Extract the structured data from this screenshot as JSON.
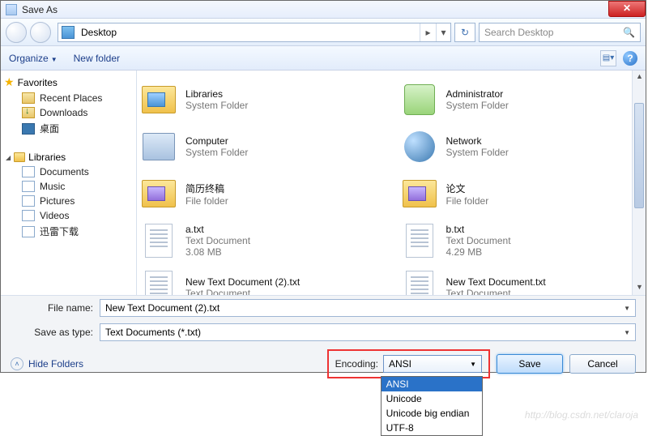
{
  "window": {
    "title": "Save As"
  },
  "nav": {
    "location": "Desktop",
    "chevron": "▸",
    "refresh_glyph": "↻"
  },
  "search": {
    "placeholder": "Search Desktop"
  },
  "toolbar": {
    "organize": "Organize",
    "new_folder": "New folder"
  },
  "sidebar": {
    "favorites_label": "Favorites",
    "favorites": [
      {
        "label": "Recent Places",
        "ic": "recent"
      },
      {
        "label": "Downloads",
        "ic": "dl"
      },
      {
        "label": "桌面",
        "ic": "desk"
      }
    ],
    "libraries_label": "Libraries",
    "libraries": [
      {
        "label": "Documents",
        "ic": "doc"
      },
      {
        "label": "Music",
        "ic": "music"
      },
      {
        "label": "Pictures",
        "ic": "pic"
      },
      {
        "label": "Videos",
        "ic": "vid"
      },
      {
        "label": "迅雷下载",
        "ic": "xl"
      }
    ]
  },
  "items": [
    {
      "name": "Libraries",
      "desc": "System Folder",
      "icon": "fold-blue"
    },
    {
      "name": "Administrator",
      "desc": "System Folder",
      "icon": "user"
    },
    {
      "name": "Computer",
      "desc": "System Folder",
      "icon": "comp"
    },
    {
      "name": "Network",
      "desc": "System Folder",
      "icon": "globe"
    },
    {
      "name": "简历终稿",
      "desc": "File folder",
      "icon": "fold-purple"
    },
    {
      "name": "论文",
      "desc": "File folder",
      "icon": "fold-purple"
    },
    {
      "name": "a.txt",
      "desc": "Text Document",
      "desc2": "3.08 MB",
      "icon": "txt"
    },
    {
      "name": "b.txt",
      "desc": "Text Document",
      "desc2": "4.29 MB",
      "icon": "txt"
    },
    {
      "name": "New Text Document (2).txt",
      "desc": "Text Document",
      "icon": "txt"
    },
    {
      "name": "New Text Document.txt",
      "desc": "Text Document",
      "icon": "txt"
    }
  ],
  "fields": {
    "file_name_label": "File name:",
    "file_name_value": "New Text Document (2).txt",
    "save_type_label": "Save as type:",
    "save_type_value": "Text Documents (*.txt)"
  },
  "bottom": {
    "hide_folders": "Hide Folders",
    "encoding_label": "Encoding:",
    "encoding_value": "ANSI",
    "encoding_options": [
      "ANSI",
      "Unicode",
      "Unicode big endian",
      "UTF-8"
    ],
    "save": "Save",
    "cancel": "Cancel"
  },
  "watermark": "http://blog.csdn.net/claroja"
}
